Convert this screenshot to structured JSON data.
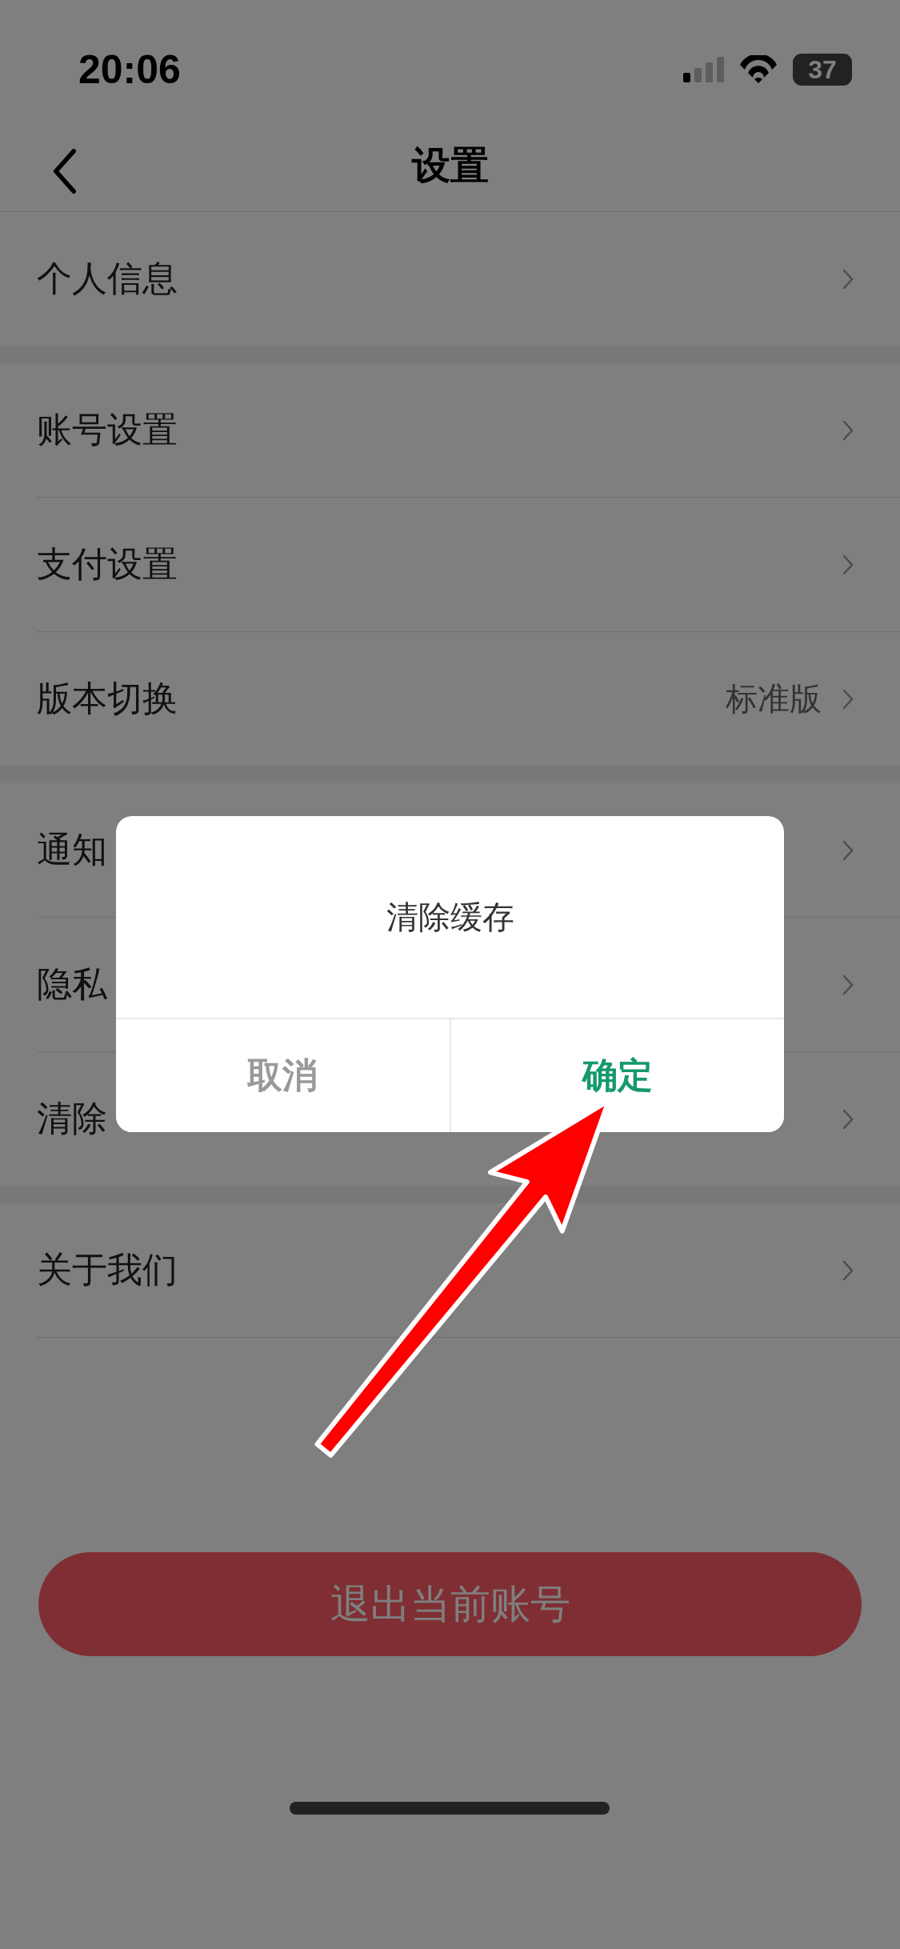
{
  "status_bar": {
    "time": "20:06",
    "battery": "37"
  },
  "nav": {
    "title": "设置"
  },
  "groups": [
    {
      "items": [
        {
          "label": "个人信息"
        }
      ]
    },
    {
      "items": [
        {
          "label": "账号设置"
        },
        {
          "label": "支付设置"
        },
        {
          "label": "版本切换",
          "value": "标准版"
        }
      ]
    },
    {
      "items": [
        {
          "label": "通知"
        },
        {
          "label": "隐私"
        },
        {
          "label": "清除"
        }
      ]
    },
    {
      "items": [
        {
          "label": "关于我们"
        }
      ]
    }
  ],
  "logout_button": {
    "label": "退出当前账号"
  },
  "dialog": {
    "title": "清除缓存",
    "buttons": [
      {
        "label": "取消",
        "kind": "cancel"
      },
      {
        "label": "确定",
        "kind": "confirm"
      }
    ]
  }
}
